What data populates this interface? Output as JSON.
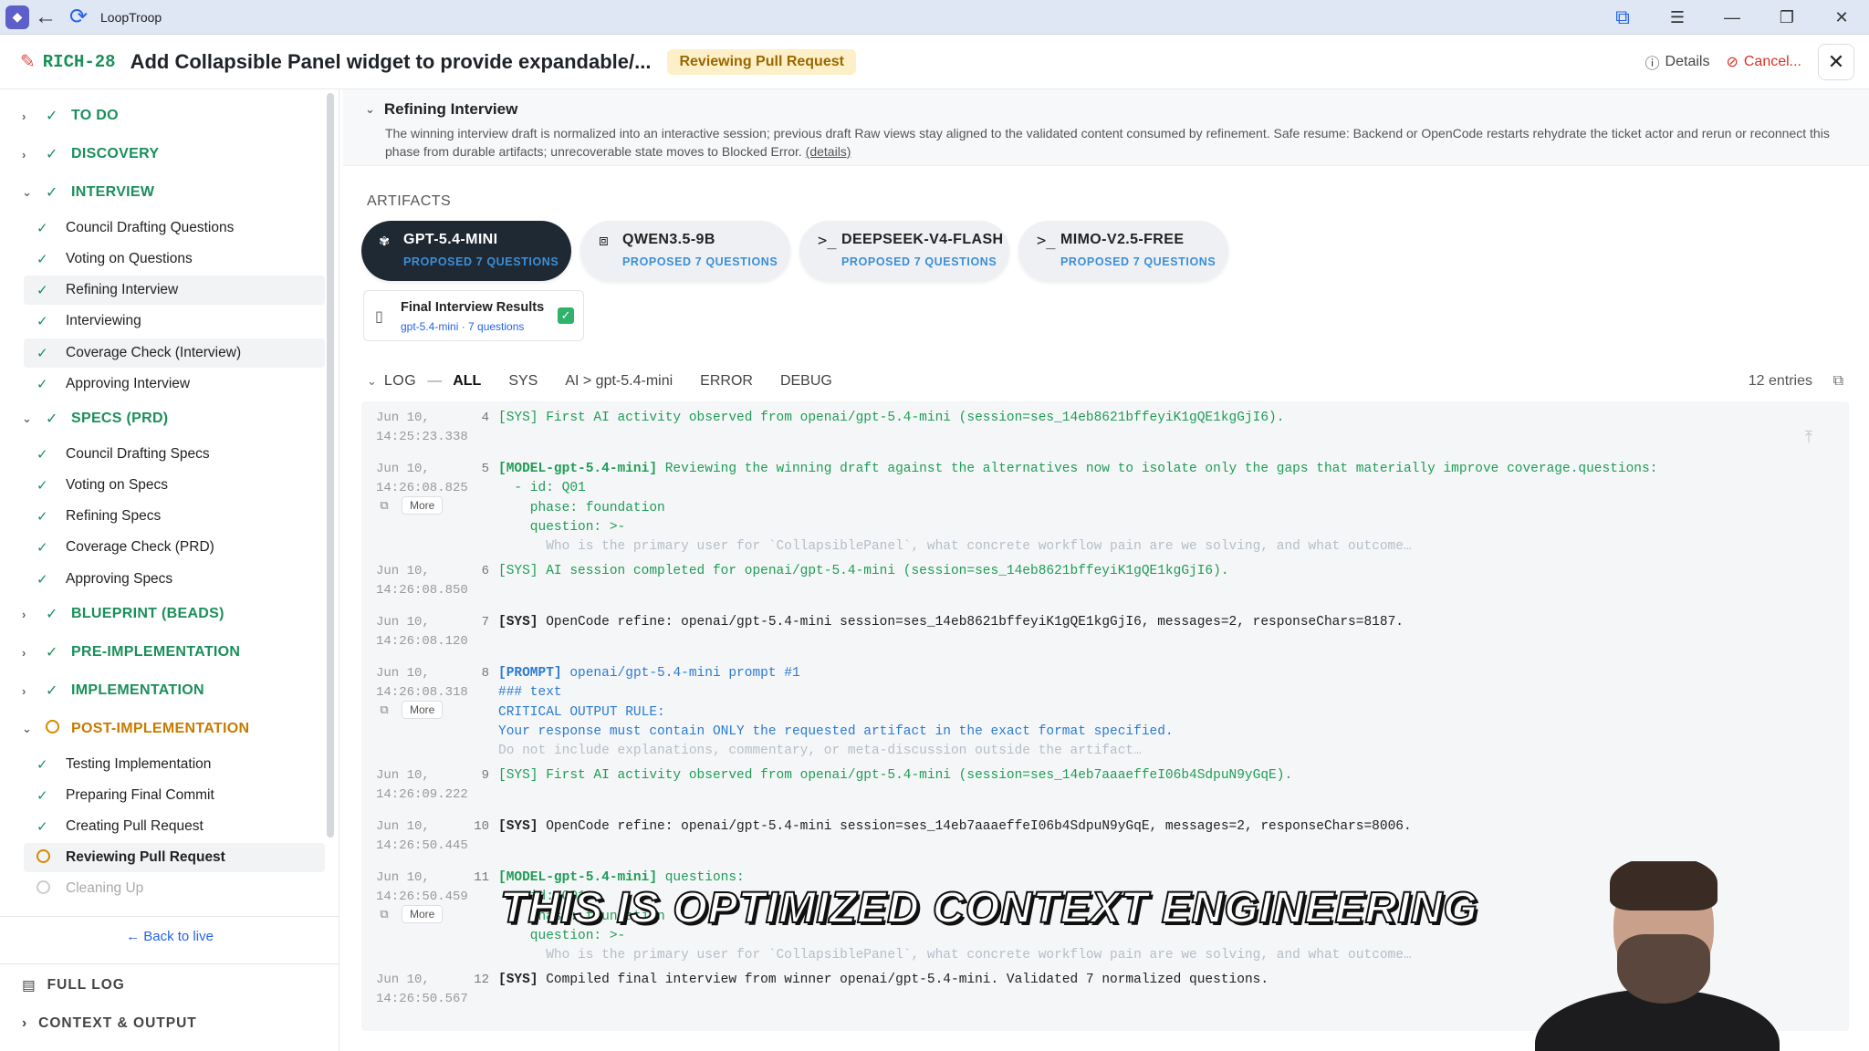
{
  "window": {
    "app_title": "LoopTroop",
    "controls": [
      "minimize",
      "maximize",
      "close"
    ]
  },
  "header": {
    "ticket_id": "RICH-28",
    "title": "Add Collapsible Panel widget to provide expandable/...",
    "status": "Reviewing Pull Request",
    "details_label": "Details",
    "cancel_label": "Cancel...",
    "close_label": "✕"
  },
  "sidebar": {
    "phases": [
      {
        "label": "TO DO",
        "state": "done",
        "expanded": false
      },
      {
        "label": "DISCOVERY",
        "state": "done",
        "expanded": false
      },
      {
        "label": "INTERVIEW",
        "state": "done",
        "expanded": true,
        "steps": [
          "Council Drafting Questions",
          "Voting on Questions",
          "Refining Interview",
          "Interviewing",
          "Coverage Check (Interview)",
          "Approving Interview"
        ]
      },
      {
        "label": "SPECS (PRD)",
        "state": "done",
        "expanded": true,
        "steps": [
          "Council Drafting Specs",
          "Voting on Specs",
          "Refining Specs",
          "Coverage Check (PRD)",
          "Approving Specs"
        ]
      },
      {
        "label": "BLUEPRINT (BEADS)",
        "state": "done",
        "expanded": false
      },
      {
        "label": "PRE-IMPLEMENTATION",
        "state": "done",
        "expanded": false
      },
      {
        "label": "IMPLEMENTATION",
        "state": "done",
        "expanded": false
      },
      {
        "label": "POST-IMPLEMENTATION",
        "state": "in-progress",
        "expanded": true,
        "steps": [
          "Testing Implementation",
          "Preparing Final Commit",
          "Creating Pull Request",
          "Reviewing Pull Request",
          "Cleaning Up"
        ]
      }
    ],
    "back_to_live": "← Back to live",
    "full_log": "FULL LOG",
    "context_output": "CONTEXT & OUTPUT"
  },
  "main": {
    "section_title": "Refining Interview",
    "section_description": "The winning interview draft is normalized into an interactive session; previous draft Raw views stay aligned to the validated content consumed by refinement. Safe resume: Backend or OpenCode restarts rehydrate the ticket actor and rerun or reconnect this phase from durable artifacts; unrecoverable state moves to Blocked Error.",
    "details_link": "(details)",
    "artifacts_label": "ARTIFACTS",
    "models": [
      {
        "name": "GPT-5.4-MINI",
        "sub": "PROPOSED 7 QUESTIONS",
        "icon": "winner-icon",
        "selected": true
      },
      {
        "name": "QWEN3.5-9B",
        "sub": "PROPOSED 7 QUESTIONS",
        "icon": "model-icon",
        "selected": false
      },
      {
        "name": "DEEPSEEK-V4-FLASH",
        "sub": "PROPOSED 7 QUESTIONS",
        "icon": "terminal-icon",
        "selected": false
      },
      {
        "name": "MIMO-V2.5-FREE",
        "sub": "PROPOSED 7 QUESTIONS",
        "icon": "terminal-icon",
        "selected": false
      }
    ],
    "final_card": {
      "title": "Final Interview Results",
      "sub": "gpt-5.4-mini · 7 questions"
    },
    "log": {
      "label": "LOG",
      "filters": [
        "ALL",
        "SYS",
        "AI > gpt-5.4-mini",
        "ERROR",
        "DEBUG"
      ],
      "active_filter": "ALL",
      "entries_count": "12 entries",
      "more_label": "More",
      "entries": [
        {
          "num": "4",
          "date": "Jun 10,",
          "time": "14:25:23.338",
          "lines": [
            {
              "text": "[SYS] First AI activity observed from openai/gpt-5.4-mini (session=ses_14eb8621bffeyiK1gQE1kgGjI6).",
              "style": "green"
            }
          ]
        },
        {
          "num": "5",
          "date": "Jun 10,",
          "time": "14:26:08.825",
          "lines": [
            {
              "tag": "[MODEL-gpt-5.4-mini]",
              "text": " Reviewing the winning draft against the alternatives now to isolate only the gaps that materially improve coverage.questions:",
              "style": "green"
            },
            {
              "text": "  - id: Q01",
              "style": "green"
            },
            {
              "text": "    phase: foundation",
              "style": "green"
            },
            {
              "text": "    question: >-",
              "style": "green"
            },
            {
              "text": "      Who is the primary user for `CollapsiblePanel`, what concrete workflow pain are we solving, and what outcome…",
              "style": "faded"
            }
          ]
        },
        {
          "num": "6",
          "date": "Jun 10,",
          "time": "14:26:08.850",
          "lines": [
            {
              "text": "[SYS] AI session completed for openai/gpt-5.4-mini (session=ses_14eb8621bffeyiK1gQE1kgGjI6).",
              "style": "green"
            }
          ]
        },
        {
          "num": "7",
          "date": "Jun 10,",
          "time": "14:26:08.120",
          "lines": [
            {
              "tag": "[SYS]",
              "text": " OpenCode refine: openai/gpt-5.4-mini session=ses_14eb8621bffeyiK1gQE1kgGjI6, messages=2, responseChars=8187.",
              "style": "black"
            }
          ]
        },
        {
          "num": "8",
          "date": "Jun 10,",
          "time": "14:26:08.318",
          "lines": [
            {
              "tag": "[PROMPT]",
              "text": " openai/gpt-5.4-mini prompt #1",
              "style": "blue"
            },
            {
              "text": "### text",
              "style": "blue"
            },
            {
              "text": "CRITICAL OUTPUT RULE:",
              "style": "blue"
            },
            {
              "text": "Your response must contain ONLY the requested artifact in the exact format specified.",
              "style": "blue"
            },
            {
              "text": "Do not include explanations, commentary, or meta-discussion outside the artifact…",
              "style": "faded"
            }
          ]
        },
        {
          "num": "9",
          "date": "Jun 10,",
          "time": "14:26:09.222",
          "lines": [
            {
              "text": "[SYS] First AI activity observed from openai/gpt-5.4-mini (session=ses_14eb7aaaeffeI06b4SdpuN9yGqE).",
              "style": "green"
            }
          ]
        },
        {
          "num": "10",
          "date": "Jun 10,",
          "time": "14:26:50.445",
          "lines": [
            {
              "tag": "[SYS]",
              "text": " OpenCode refine: openai/gpt-5.4-mini session=ses_14eb7aaaeffeI06b4SdpuN9yGqE, messages=2, responseChars=8006.",
              "style": "black"
            }
          ]
        },
        {
          "num": "11",
          "date": "Jun 10,",
          "time": "14:26:50.459",
          "lines": [
            {
              "tag": "[MODEL-gpt-5.4-mini]",
              "text": " questions:",
              "style": "green"
            },
            {
              "text": "  - id: Q01",
              "style": "green"
            },
            {
              "text": "    phase: foundation",
              "style": "green"
            },
            {
              "text": "    question: >-",
              "style": "green"
            },
            {
              "text": "      Who is the primary user for `CollapsiblePanel`, what concrete workflow pain are we solving, and what outcome…",
              "style": "faded"
            }
          ]
        },
        {
          "num": "12",
          "date": "Jun 10,",
          "time": "14:26:50.567",
          "lines": [
            {
              "tag": "[SYS]",
              "text": " Compiled final interview from winner openai/gpt-5.4-mini. Validated 7 normalized questions.",
              "style": "black"
            }
          ]
        }
      ]
    }
  },
  "caption": "THIS IS OPTIMIZED CONTEXT ENGINEERING",
  "colors": {
    "done": "#1a8f5a",
    "in_progress": "#d48a00",
    "link": "#2563eb",
    "selected_card": "#1f2933"
  }
}
